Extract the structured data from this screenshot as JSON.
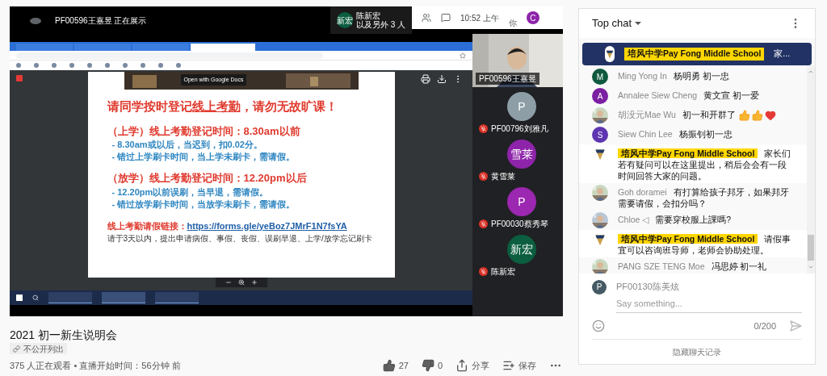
{
  "video": {
    "meet_header": {
      "presenter": "PF00596王嘉昱 正在展示",
      "participant_avatar": {
        "initials": "新宏",
        "color": "#0b5e3f"
      },
      "participant_name": "陈新宏",
      "others": "以及另外 3 人",
      "time": "10:52 上午",
      "you_label": "你",
      "user_avatar": {
        "initial": "C",
        "color": "#8e24aa"
      }
    },
    "pdf": {
      "open_button": "Open with Google Docs",
      "heading": [
        {
          "text": "请同学按时登记",
          "underline": false
        },
        {
          "text": "线上考勤",
          "underline": true
        },
        {
          "text": "，请勿无故旷课！",
          "underline": false
        }
      ],
      "sections": [
        {
          "title": "（上学）线上考勤登记时间：8.30am以前",
          "lines": [
            "- 8.30am或以后，当迟到，扣0.02分。",
            "- 错过上学刷卡时间，当上学未刷卡，需请假。"
          ]
        },
        {
          "title": "（放学）线上考勤登记时间：12.20pm以后",
          "lines": [
            "- 12.20pm以前误刷，当早退，需请假。",
            "- 错过放学刷卡时间，当放学未刷卡，需请假。"
          ]
        }
      ],
      "link_label": "线上考勤请假链接：",
      "link": "https://forms.gle/yeBoz7JMrF1N7fsYA",
      "note": "请于3天以内，提出申请病假、事假、丧假、误刷早退、上学/放学忘记刷卡"
    },
    "browser_tabs": [
      {
        "selected": false
      },
      {
        "selected": false
      },
      {
        "selected": false
      },
      {
        "selected": true
      }
    ],
    "self_view": {
      "name": "PF00596王嘉昱"
    },
    "participants": [
      {
        "initials": "P",
        "color": "#8d9ea7",
        "name": "PF00796刘雅凡",
        "muted": true
      },
      {
        "initials": "雪莱",
        "color": "#8e24aa",
        "name": "黄雪莱",
        "muted": true
      },
      {
        "initials": "P",
        "color": "#9c27b0",
        "name": "PF00030蔡秀琴",
        "muted": true
      },
      {
        "initials": "新宏",
        "color": "#0b5e3f",
        "name": "陈新宏",
        "muted": true
      }
    ]
  },
  "title": "2021 初一新生说明会",
  "visibility": "不公开列出",
  "stats": "375 人正在观看 • 直播开始时间：56分钟 前",
  "actions": {
    "likes": "27",
    "dislikes": "0",
    "share": "分享",
    "save": "保存"
  },
  "chat": {
    "title": "Top chat",
    "pinned": {
      "author": "培风中学Pay Fong Middle School",
      "text": "家..."
    },
    "messages": [
      {
        "kind": "member",
        "avatar": {
          "kind": "letter",
          "letter": "M",
          "color": "#0f5a3f"
        },
        "author": "Ming Yong In",
        "text": "杨明勇 初一忠"
      },
      {
        "kind": "member",
        "avatar": {
          "kind": "letter",
          "letter": "A",
          "color": "#7b1fa2"
        },
        "author": "Annalee Siew Cheng",
        "text": "黄文宣 初一爱"
      },
      {
        "kind": "member",
        "avatar": {
          "kind": "picture"
        },
        "author": "胡没元Mae Wu",
        "text": "初一和开群了",
        "emoji": [
          {
            "kind": "thumbs_up"
          },
          {
            "kind": "thumbs_up"
          },
          {
            "kind": "heart"
          }
        ]
      },
      {
        "kind": "member",
        "avatar": {
          "kind": "letter",
          "letter": "S",
          "color": "#5e35b1"
        },
        "author": "Siew Chin Lee",
        "text": "杨振钊初一忠"
      },
      {
        "kind": "owner",
        "avatar": {
          "kind": "logo"
        },
        "author": "培风中学Pay Fong Middle School",
        "text": "家长们若有疑问可以在这里提出，稍后会会有一段时间回答大家的问题。"
      },
      {
        "kind": "member",
        "avatar": {
          "kind": "picture"
        },
        "author": "Goh doramei",
        "text": "有打算给孩子邦牙，如果邦牙需要请假，会扣分吗？"
      },
      {
        "kind": "member",
        "avatar": {
          "kind": "picture"
        },
        "author": "Chloe ◁",
        "text": "需要穿校服上課嗎?"
      },
      {
        "kind": "owner",
        "avatar": {
          "kind": "logo"
        },
        "author": "培风中学Pay Fong Middle School",
        "text": "请假事宜可以咨询班导师，老师会协助处理。"
      },
      {
        "kind": "member",
        "avatar": {
          "kind": "picture"
        },
        "author": "PANG SZE TENG Moe",
        "text": "冯思婷 初一礼"
      }
    ],
    "input": {
      "avatar": {
        "letter": "P",
        "color": "#455a64"
      },
      "user": "PF00130陈美炫",
      "placeholder": "Say something...",
      "counter": "0/200"
    },
    "hide_button": "隐藏聊天记录"
  }
}
